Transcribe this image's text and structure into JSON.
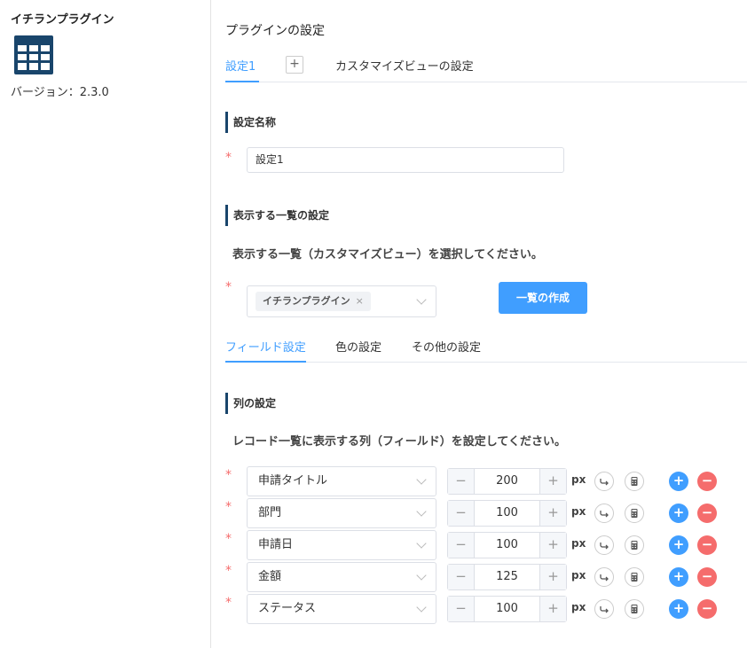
{
  "sidebar": {
    "plugin_name": "イチランプラグイン",
    "version_label": "バージョン：2.3.0",
    "logo_icon": "table-grid-icon",
    "logo_color": "#19456b"
  },
  "main": {
    "title": "プラグインの設定",
    "tabs": {
      "active": "設定1",
      "add": "+",
      "customize": "カスタマイズビューの設定"
    },
    "setting_name": {
      "header": "設定名称",
      "value": "設定1"
    },
    "list_setting": {
      "header": "表示する一覧の設定",
      "description": "表示する一覧（カスタマイズビュー）を選択してください。",
      "selected_tag": "イチランプラグイン",
      "tag_close": "×",
      "create_button": "一覧の作成"
    },
    "sub_tabs": {
      "field": "フィールド設定",
      "color": "色の設定",
      "other": "その他の設定"
    },
    "column_setting": {
      "header": "列の設定",
      "description": "レコード一覧に表示する列（フィールド）を設定してください。",
      "unit": "px",
      "minus": "−",
      "plus": "+",
      "rows": [
        {
          "field": "申請タイトル",
          "width": "200"
        },
        {
          "field": "部門",
          "width": "100"
        },
        {
          "field": "申請日",
          "width": "100"
        },
        {
          "field": "金額",
          "width": "125"
        },
        {
          "field": "ステータス",
          "width": "100"
        }
      ]
    }
  },
  "colors": {
    "accent": "#409eff",
    "danger": "#f56c6c",
    "brand": "#19456b"
  },
  "required_mark": "*"
}
